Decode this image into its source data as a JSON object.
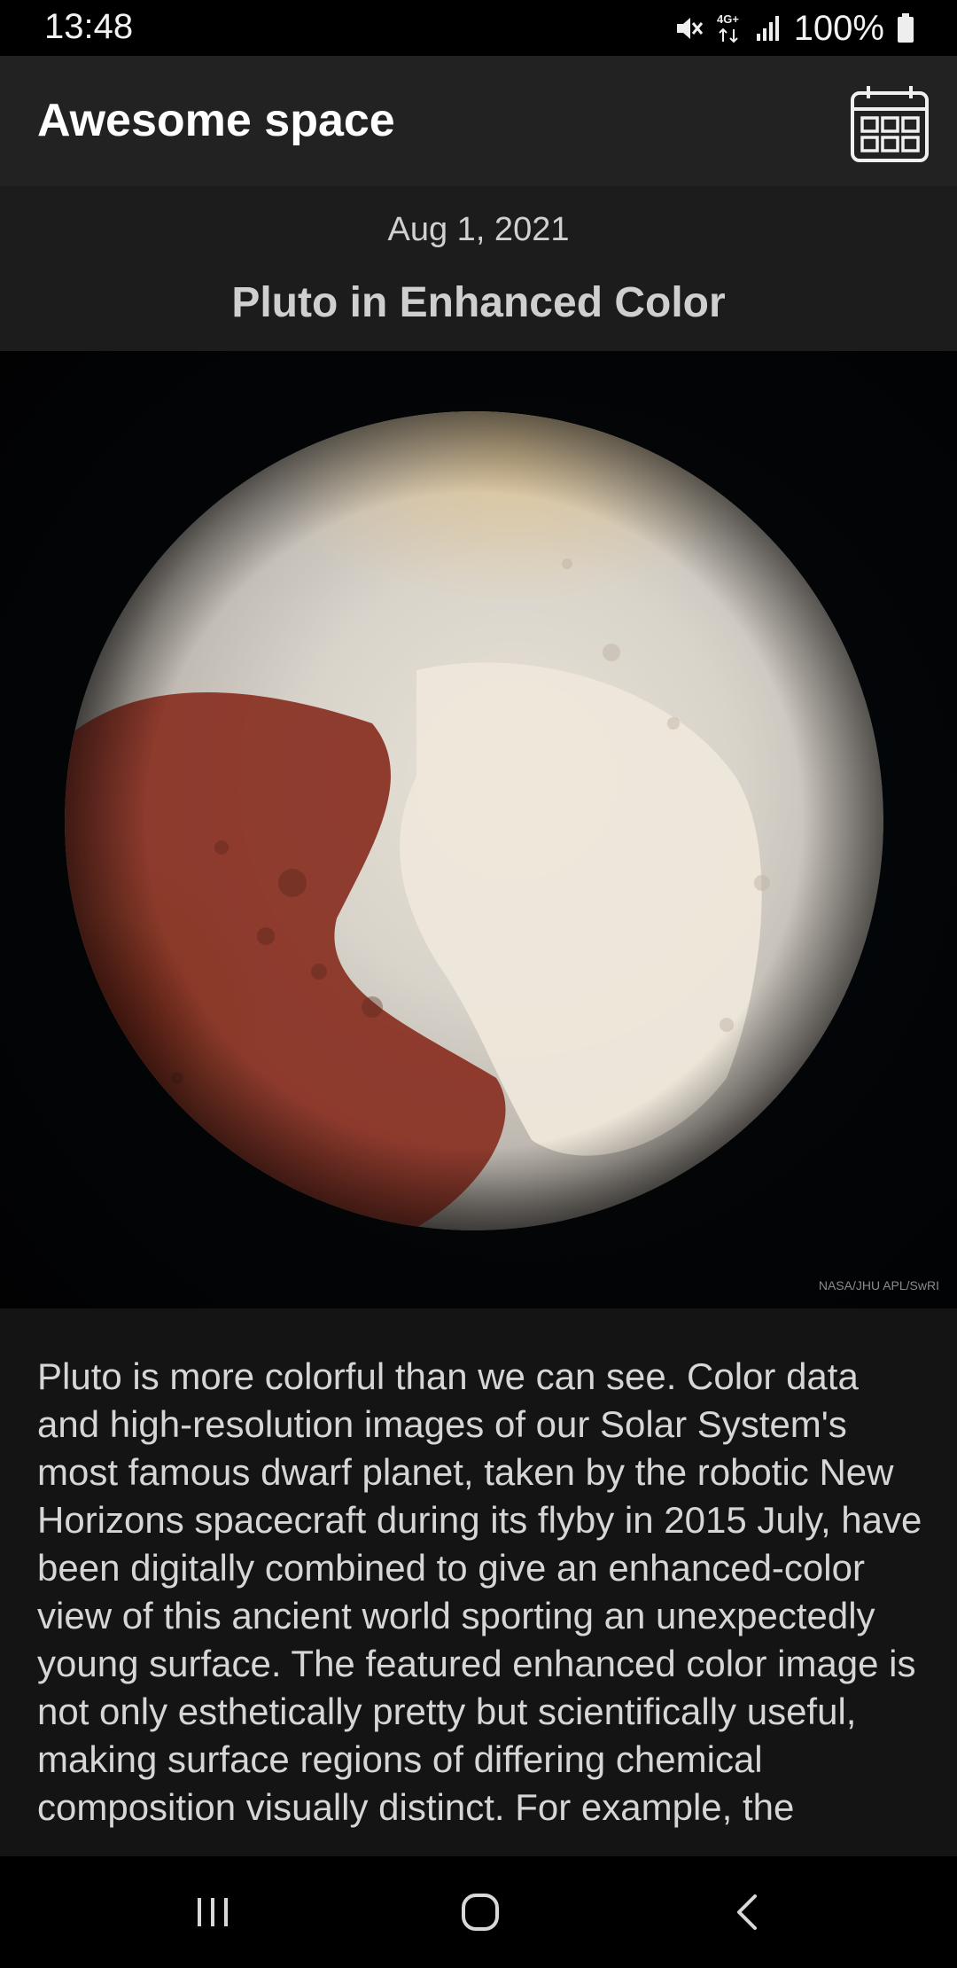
{
  "status_bar": {
    "time": "13:48",
    "network": "4G+",
    "battery": "100%",
    "icons": [
      "mute-icon",
      "network-4g-icon",
      "signal-icon",
      "battery-icon"
    ]
  },
  "app_bar": {
    "title": "Awesome space",
    "calendar_icon": "calendar-icon"
  },
  "apod": {
    "date": "Aug 1, 2021",
    "title": "Pluto in Enhanced Color",
    "image_credit": "NASA/JHU APL/SwRI",
    "description": "Pluto is more colorful than we can see. Color data and high-resolution images of our Solar System's most famous dwarf planet, taken by the robotic New Horizons spacecraft during its flyby in 2015 July, have been digitally combined to give an enhanced-color view of this ancient world sporting an unexpectedly young surface. The featured enhanced color image is not only esthetically pretty but scientifically useful, making surface regions of differing chemical composition visually distinct. For example, the"
  },
  "nav_bar": {
    "recents_icon": "recents-icon",
    "home_icon": "home-icon",
    "back_icon": "back-icon"
  },
  "colors": {
    "app_bar": "#222222",
    "header": "#1c1c1c",
    "description_bg": "#141414",
    "text": "#d6d6d6"
  }
}
